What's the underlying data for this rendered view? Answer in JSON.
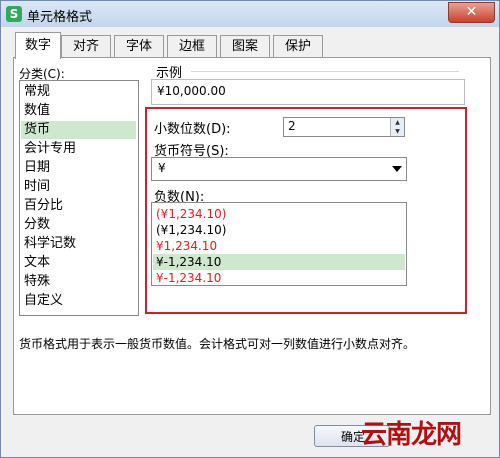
{
  "window": {
    "icon_glyph": "S",
    "title": "单元格格式",
    "close_glyph": "✕"
  },
  "tabs": [
    {
      "label": "数字"
    },
    {
      "label": "对齐"
    },
    {
      "label": "字体"
    },
    {
      "label": "边框"
    },
    {
      "label": "图案"
    },
    {
      "label": "保护"
    }
  ],
  "category": {
    "label": "分类(C):",
    "items": [
      "常规",
      "数值",
      "货币",
      "会计专用",
      "日期",
      "时间",
      "百分比",
      "分数",
      "科学记数",
      "文本",
      "特殊",
      "自定义"
    ],
    "selected": "货币"
  },
  "example": {
    "label": "示例",
    "value": "¥10,000.00"
  },
  "decimal": {
    "label": "小数位数(D):",
    "value": "2"
  },
  "currency_symbol": {
    "label": "货币符号(S):",
    "value": "¥"
  },
  "negative": {
    "label": "负数(N):",
    "items": [
      {
        "text": "(¥1,234.10)",
        "color": "#e02020"
      },
      {
        "text": "(¥1,234.10)",
        "color": "#000000"
      },
      {
        "text": "¥1,234.10",
        "color": "#e02020"
      },
      {
        "text": "¥-1,234.10",
        "color": "#000000"
      },
      {
        "text": "¥-1,234.10",
        "color": "#e02020"
      }
    ],
    "selected": "¥-1,234.10"
  },
  "description": "货币格式用于表示一般货币数值。会计格式可对一列数值进行小数点对齐。",
  "buttons": {
    "ok": "确定"
  },
  "watermark": "云南龙网",
  "colors": {
    "selection": "#cde8cd",
    "highlight_frame": "#d0202a",
    "negative_red": "#e02020"
  }
}
